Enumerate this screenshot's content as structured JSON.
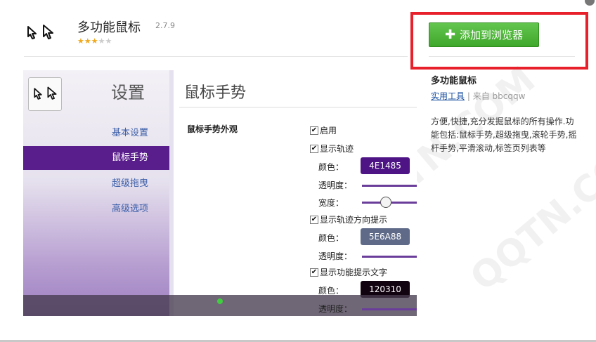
{
  "extension": {
    "title": "多功能鼠标",
    "version": "2.7.9",
    "rating_filled": 3,
    "rating_total": 5,
    "icon": "mouse-cursor-icon"
  },
  "add_button": {
    "label": "添加到浏览器",
    "icon": "plus-icon"
  },
  "sidebar_info": {
    "name": "多功能鼠标",
    "category": "实用工具",
    "separator": "|",
    "author": "来自 bbcqqw",
    "description": "方便,快捷,充分发掘鼠标的所有操作.功能包括:鼠标手势,超级拖曳,滚轮手势,摇杆手势,平滑滚动,标签页列表等"
  },
  "screenshot": {
    "settings_title": "设置",
    "nav": [
      {
        "label": "基本设置"
      },
      {
        "label": "鼠标手势"
      },
      {
        "label": "超级拖曳"
      },
      {
        "label": "高级选项"
      }
    ],
    "active_nav": "鼠标手势",
    "heading": "鼠标手势",
    "section_title": "鼠标手势外观",
    "enable_label": "启用",
    "show_trail_label": "显示轨迹",
    "color_label": "颜色：",
    "opacity_label": "透明度：",
    "width_label": "宽度：",
    "trail_color": "4E1485",
    "show_direction_label": "显示轨迹方向提示",
    "direction_color": "5E6A88",
    "show_text_label": "显示功能提示文字",
    "text_color": "120310",
    "colors": {
      "trail": "#4e1485",
      "direction": "#5e6a88",
      "text": "#120310"
    }
  },
  "watermark": "QQTN.COM"
}
